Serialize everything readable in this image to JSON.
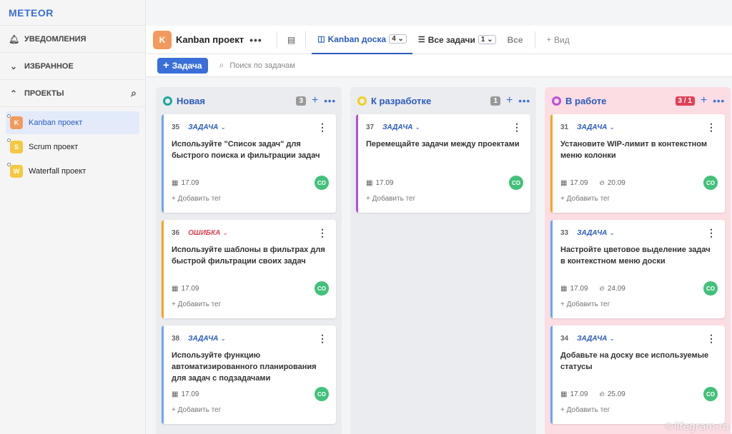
{
  "app": {
    "logo": "METEOR"
  },
  "sidebar": {
    "notifications": "Уведомления",
    "favorites": "Избранное",
    "projects": "Проекты",
    "project_list": [
      {
        "label": "Kanban проект",
        "letter": "K",
        "color": "#f29a5d"
      },
      {
        "label": "Scrum проект",
        "letter": "S",
        "color": "#f5c842"
      },
      {
        "label": "Waterfall проект",
        "letter": "W",
        "color": "#f5c842"
      }
    ]
  },
  "topbar": {
    "project_letter": "K",
    "project_title": "Kanban проект",
    "more": "•••",
    "tabs": [
      {
        "label": "Kanban доска",
        "count": "4"
      },
      {
        "label": "Все задачи",
        "count": "1"
      },
      {
        "label": "Все"
      },
      {
        "label": "Вид"
      }
    ]
  },
  "actions": {
    "add_label": "Задача",
    "search_placeholder": "Поиск по задачам"
  },
  "columns": [
    {
      "title": "Новая",
      "count": "3",
      "ring": "#1aa89c",
      "cards": [
        {
          "id": "35",
          "type": "ЗАДАЧА",
          "title": "Используйте \"Список задач\" для быстрого поиска и фильтрации задач",
          "date": "17.09",
          "deadline": "",
          "avatar": "CO",
          "tag": "+ Добавить тег",
          "bar": "#6aa8f0"
        },
        {
          "id": "36",
          "type": "ОШИБКА",
          "title": "Используйте шаблоны в фильтрах для быстрой фильтрации своих задач",
          "date": "17.09",
          "deadline": "",
          "avatar": "CO",
          "tag": "+ Добавить тег",
          "bar": "#f5a623"
        },
        {
          "id": "38",
          "type": "ЗАДАЧА",
          "title": "Используйте функцию автоматизированного планирования для задач с подзадачами",
          "date": "17.09",
          "deadline": "",
          "avatar": "CO",
          "tag": "+ Добавить тег",
          "bar": "#6aa8f0"
        }
      ]
    },
    {
      "title": "К разработке",
      "count": "1",
      "ring": "#f0d020",
      "cards": [
        {
          "id": "37",
          "type": "ЗАДАЧА",
          "title": "Перемещайте задачи между проектами",
          "date": "17.09",
          "deadline": "",
          "avatar": "CO",
          "tag": "+ Добавить тег",
          "bar": "#b44fd6"
        }
      ]
    },
    {
      "title": "В работе",
      "count": "3 / 1",
      "ring": "#c24fd6",
      "cards": [
        {
          "id": "31",
          "type": "ЗАДАЧА",
          "title": "Установите WIP-лимит в контекстном меню колонки",
          "date": "17.09",
          "deadline": "20.09",
          "avatar": "CO",
          "tag": "+ Добавить тег",
          "bar": "#f5a623"
        },
        {
          "id": "33",
          "type": "ЗАДАЧА",
          "title": "Настройте цветовое выделение задач в контекстном меню доски",
          "date": "17.09",
          "deadline": "24.09",
          "avatar": "CO",
          "tag": "+ Добавить тег",
          "bar": "#6aa8f0"
        },
        {
          "id": "34",
          "type": "ЗАДАЧА",
          "title": "Добавьте на доску все используемые статусы",
          "date": "17.09",
          "deadline": "25.09",
          "avatar": "CO",
          "tag": "+ Добавить тег",
          "bar": "#6aa8f0"
        }
      ]
    }
  ],
  "watermark": "©lifegram.ru"
}
